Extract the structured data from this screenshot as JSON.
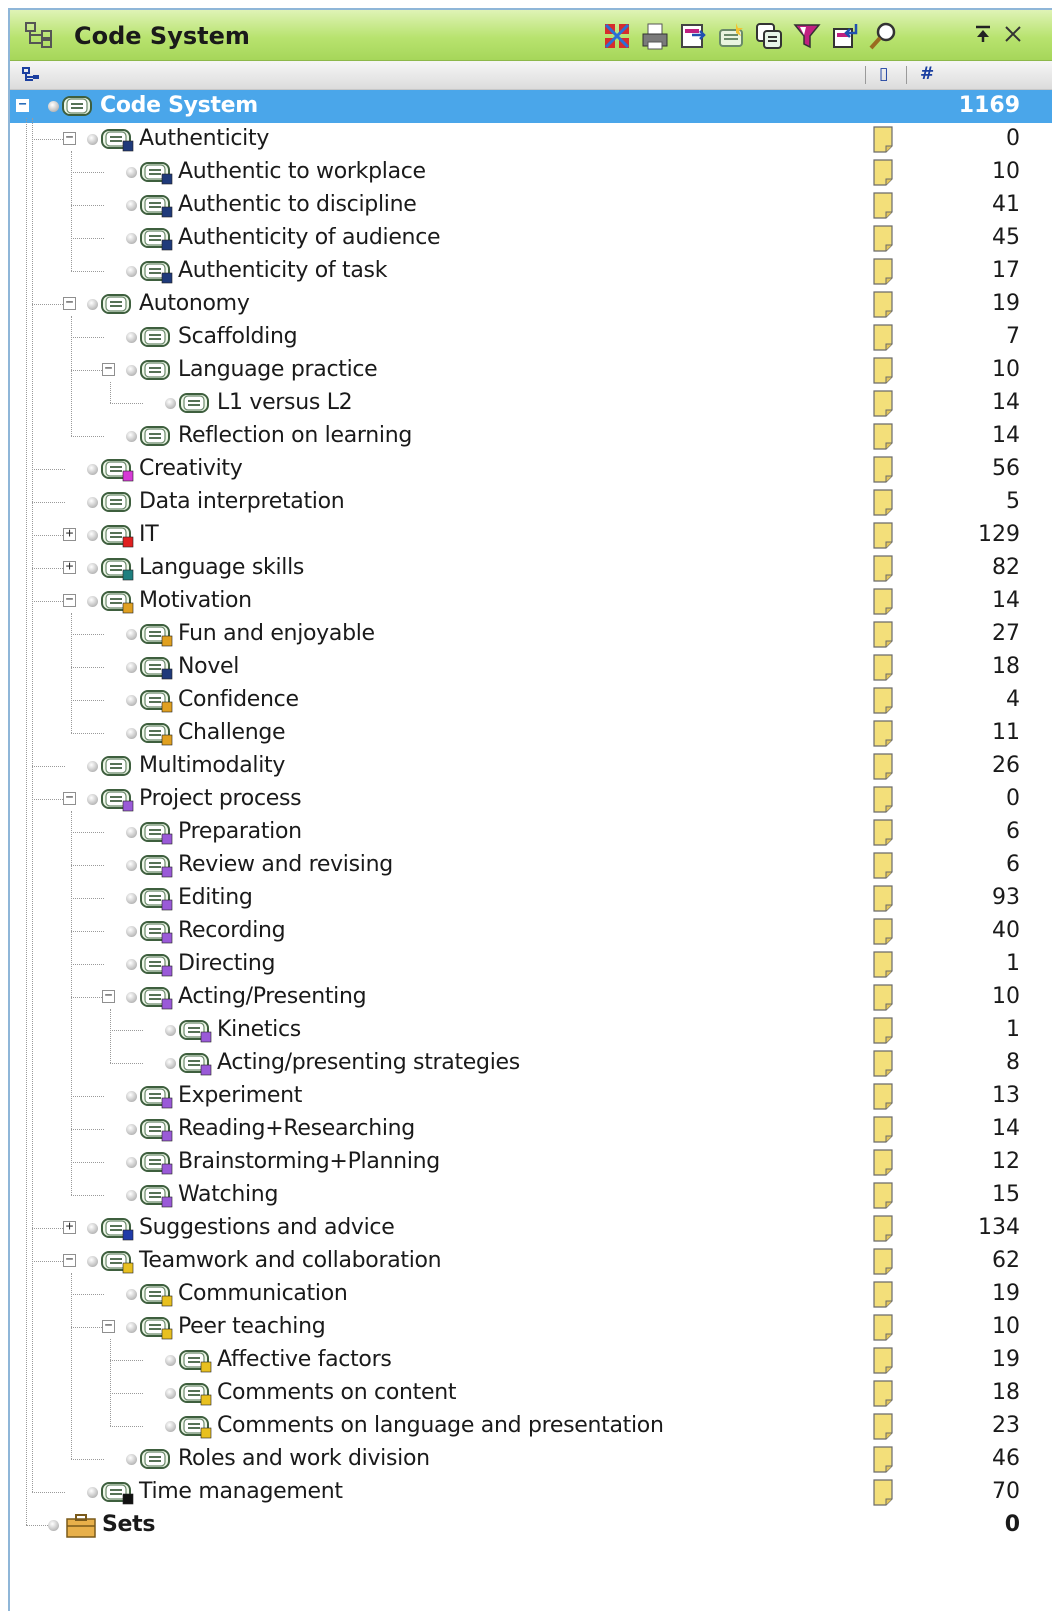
{
  "window": {
    "title": "Code System",
    "title_icon": "code-system-icon",
    "toolbar_icons": [
      "activate-all-icon",
      "print-icon",
      "export-icon",
      "new-code-icon",
      "copy-icon",
      "filter-icon",
      "import-icon",
      "search-icon"
    ],
    "pin_icon": "pin-icon",
    "close_icon": "close-icon"
  },
  "columns": {
    "memo_header": "▯",
    "count_header": "#"
  },
  "colors": {
    "title_gradient": "#b8e36f",
    "selection": "#4aa6ea",
    "memo": "#f3df7a"
  },
  "tree": [
    {
      "label": "Code System",
      "count": "1169",
      "level": 0,
      "expander": "minus",
      "color": "",
      "root": true
    },
    {
      "label": "Authenticity",
      "count": "0",
      "level": 1,
      "expander": "minus",
      "color": "#1f3a7a"
    },
    {
      "label": "Authentic to workplace",
      "count": "10",
      "level": 2,
      "expander": "",
      "color": "#1f3a7a"
    },
    {
      "label": "Authentic to discipline",
      "count": "41",
      "level": 2,
      "expander": "",
      "color": "#1f3a7a"
    },
    {
      "label": "Authenticity of audience",
      "count": "45",
      "level": 2,
      "expander": "",
      "color": "#1f3a7a"
    },
    {
      "label": "Authenticity of task",
      "count": "17",
      "level": 2,
      "expander": "",
      "color": "#1f3a7a"
    },
    {
      "label": "Autonomy",
      "count": "19",
      "level": 1,
      "expander": "minus",
      "color": ""
    },
    {
      "label": "Scaffolding",
      "count": "7",
      "level": 2,
      "expander": "",
      "color": ""
    },
    {
      "label": "Language practice",
      "count": "10",
      "level": 2,
      "expander": "minus",
      "color": ""
    },
    {
      "label": "L1 versus L2",
      "count": "14",
      "level": 3,
      "expander": "",
      "color": ""
    },
    {
      "label": "Reflection on learning",
      "count": "14",
      "level": 2,
      "expander": "",
      "color": ""
    },
    {
      "label": "Creativity",
      "count": "56",
      "level": 1,
      "expander": "",
      "color": "#d63ad6"
    },
    {
      "label": "Data interpretation",
      "count": "5",
      "level": 1,
      "expander": "",
      "color": ""
    },
    {
      "label": "IT",
      "count": "129",
      "level": 1,
      "expander": "plus",
      "color": "#e02020"
    },
    {
      "label": "Language skills",
      "count": "82",
      "level": 1,
      "expander": "plus",
      "color": "#1e7f7f"
    },
    {
      "label": "Motivation",
      "count": "14",
      "level": 1,
      "expander": "minus",
      "color": "#e0a020"
    },
    {
      "label": "Fun and enjoyable",
      "count": "27",
      "level": 2,
      "expander": "",
      "color": "#e0a020"
    },
    {
      "label": "Novel",
      "count": "18",
      "level": 2,
      "expander": "",
      "color": "#1f3a7a"
    },
    {
      "label": "Confidence",
      "count": "4",
      "level": 2,
      "expander": "",
      "color": "#e0a020"
    },
    {
      "label": "Challenge",
      "count": "11",
      "level": 2,
      "expander": "",
      "color": "#e0a020"
    },
    {
      "label": "Multimodality",
      "count": "26",
      "level": 1,
      "expander": "",
      "color": ""
    },
    {
      "label": "Project process",
      "count": "0",
      "level": 1,
      "expander": "minus",
      "color": "#9a5ad8"
    },
    {
      "label": "Preparation",
      "count": "6",
      "level": 2,
      "expander": "",
      "color": "#9a5ad8"
    },
    {
      "label": "Review and revising",
      "count": "6",
      "level": 2,
      "expander": "",
      "color": "#9a5ad8"
    },
    {
      "label": "Editing",
      "count": "93",
      "level": 2,
      "expander": "",
      "color": "#9a5ad8"
    },
    {
      "label": "Recording",
      "count": "40",
      "level": 2,
      "expander": "",
      "color": "#9a5ad8"
    },
    {
      "label": "Directing",
      "count": "1",
      "level": 2,
      "expander": "",
      "color": "#9a5ad8"
    },
    {
      "label": "Acting/Presenting",
      "count": "10",
      "level": 2,
      "expander": "minus",
      "color": "#9a5ad8"
    },
    {
      "label": "Kinetics",
      "count": "1",
      "level": 3,
      "expander": "",
      "color": "#9a5ad8"
    },
    {
      "label": "Acting/presenting strategies",
      "count": "8",
      "level": 3,
      "expander": "",
      "color": "#9a5ad8"
    },
    {
      "label": "Experiment",
      "count": "13",
      "level": 2,
      "expander": "",
      "color": "#9a5ad8"
    },
    {
      "label": "Reading+Researching",
      "count": "14",
      "level": 2,
      "expander": "",
      "color": "#9a5ad8"
    },
    {
      "label": "Brainstorming+Planning",
      "count": "12",
      "level": 2,
      "expander": "",
      "color": "#9a5ad8"
    },
    {
      "label": "Watching",
      "count": "15",
      "level": 2,
      "expander": "",
      "color": "#9a5ad8"
    },
    {
      "label": "Suggestions and advice",
      "count": "134",
      "level": 1,
      "expander": "plus",
      "color": "#1f3aa8"
    },
    {
      "label": "Teamwork and collaboration",
      "count": "62",
      "level": 1,
      "expander": "minus",
      "color": "#e8c020"
    },
    {
      "label": "Communication",
      "count": "19",
      "level": 2,
      "expander": "",
      "color": "#e8c020"
    },
    {
      "label": "Peer teaching",
      "count": "10",
      "level": 2,
      "expander": "minus",
      "color": "#e8c020"
    },
    {
      "label": "Affective factors",
      "count": "19",
      "level": 3,
      "expander": "",
      "color": "#e8c020"
    },
    {
      "label": "Comments on content",
      "count": "18",
      "level": 3,
      "expander": "",
      "color": "#e8c020"
    },
    {
      "label": "Comments on language and presentation",
      "count": "23",
      "level": 3,
      "expander": "",
      "color": "#e8c020"
    },
    {
      "label": "Roles and work division",
      "count": "46",
      "level": 2,
      "expander": "",
      "color": ""
    },
    {
      "label": "Time management",
      "count": "70",
      "level": 1,
      "expander": "",
      "color": "#111111"
    }
  ],
  "sets": {
    "label": "Sets",
    "count": "0",
    "icon": "sets-folder-icon"
  }
}
